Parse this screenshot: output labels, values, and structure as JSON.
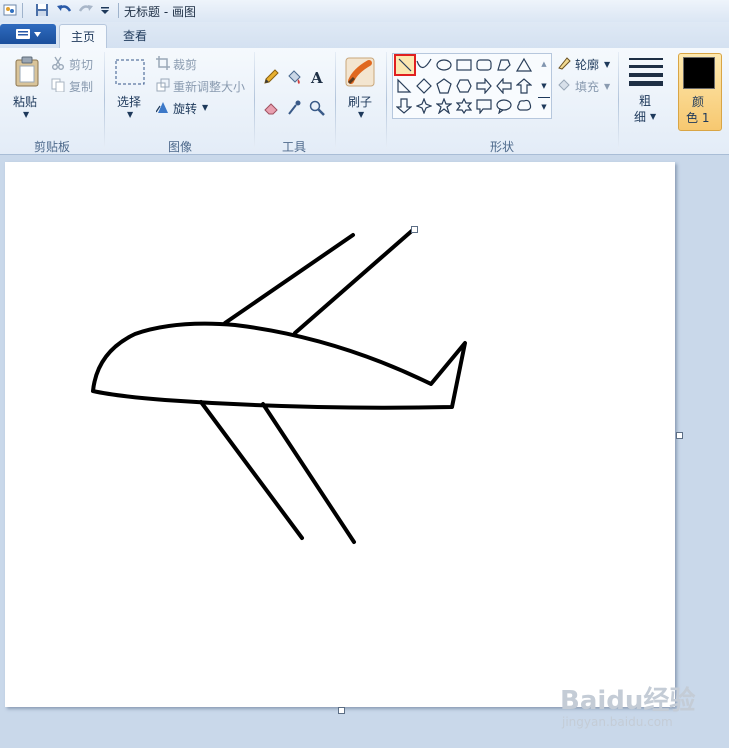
{
  "window": {
    "title": "无标题 - 画图"
  },
  "tabs": {
    "home": "主页",
    "view": "查看"
  },
  "clipboard": {
    "paste": "粘贴",
    "cut": "剪切",
    "copy": "复制",
    "group": "剪贴板"
  },
  "image": {
    "select": "选择",
    "crop": "裁剪",
    "resize": "重新调整大小",
    "rotate": "旋转",
    "group": "图像"
  },
  "tools": {
    "group": "工具"
  },
  "brushes": {
    "label": "刷子"
  },
  "shapes": {
    "outline": "轮廓",
    "fill": "填充",
    "group": "形状",
    "selected": "line"
  },
  "size": {
    "line1": "粗",
    "line2": "细"
  },
  "colors": {
    "color1_line1": "颜",
    "color1_line2": "色 1",
    "color1_value": "#000000"
  },
  "watermark": {
    "brand": "Baidu经验",
    "url": "jingyan.baidu.com"
  },
  "drawing": {
    "stroke_color": "#000000"
  }
}
